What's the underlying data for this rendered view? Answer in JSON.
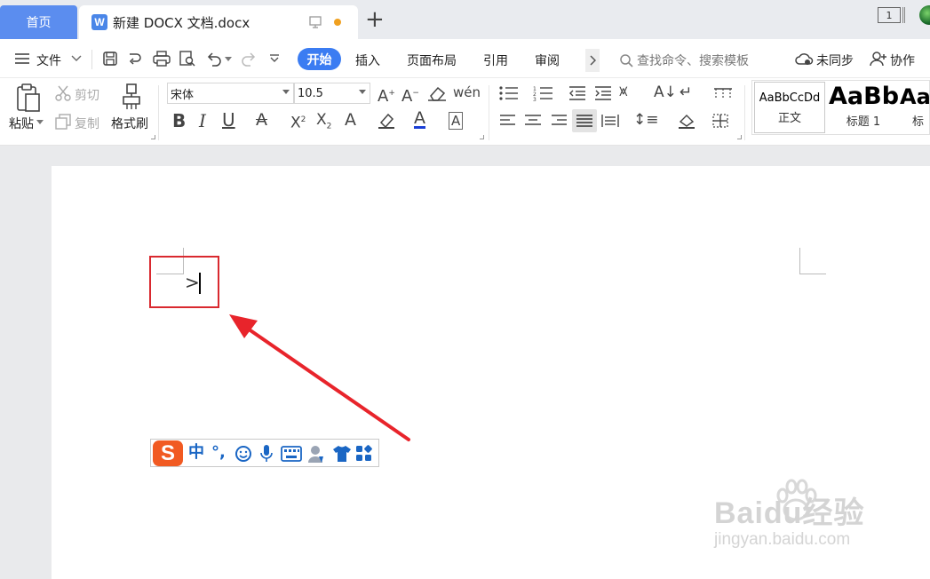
{
  "tabs": {
    "home": "首页",
    "document": "新建 DOCX 文档.docx",
    "new_tab": "+",
    "window_count": "1"
  },
  "menu": {
    "file": "文件",
    "items": [
      "开始",
      "插入",
      "页面布局",
      "引用",
      "审阅"
    ],
    "search_placeholder": "查找命令、搜索模板",
    "sync": "未同步",
    "collab": "协作"
  },
  "ribbon": {
    "paste": "粘贴",
    "cut": "剪切",
    "copy": "复制",
    "format_painter": "格式刷",
    "font_name": "宋体",
    "font_size": "10.5",
    "styles": [
      {
        "sample": "AaBbCcDd",
        "caption": "正文"
      },
      {
        "sample": "AaBb",
        "caption": "标题 1"
      },
      {
        "sample": "Aa",
        "caption": "标"
      }
    ]
  },
  "document": {
    "typed_text": ">"
  },
  "ime": {
    "logo": "S",
    "mode": "中",
    "punct": "°,"
  },
  "watermark": {
    "brand": "Baidu经验",
    "url": "jingyan.baidu.com"
  },
  "colors": {
    "accent": "#3b7cf2",
    "home_tab": "#5b8def",
    "highlight": "#d9292f",
    "ime_logo": "#f15a22",
    "ime_icon": "#1a66c4"
  }
}
